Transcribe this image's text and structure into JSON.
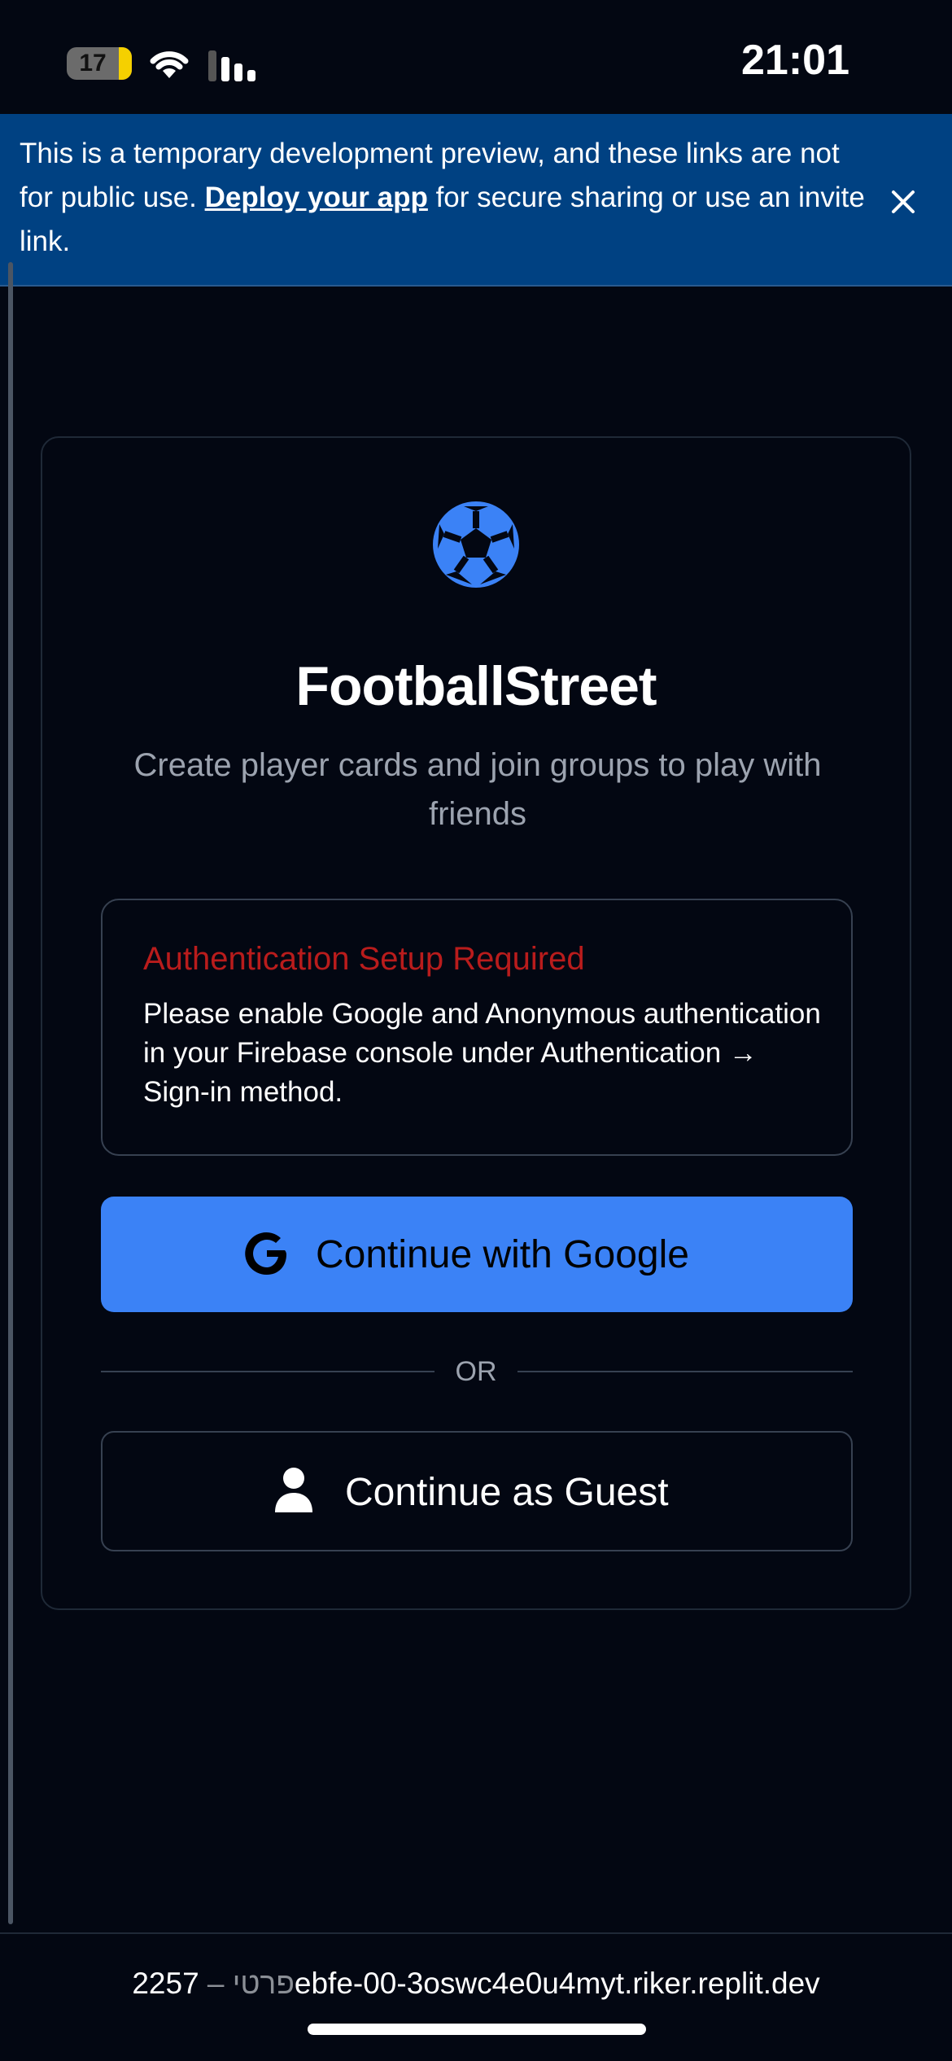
{
  "status_bar": {
    "battery_level": "17",
    "time": "21:01"
  },
  "banner": {
    "text_before": "This is a temporary development preview, and these links are not for public use. ",
    "link_text": "Deploy your app",
    "text_after": " for secure sharing or use an invite link.",
    "close_icon": "close-icon"
  },
  "auth_card": {
    "logo_icon": "soccer-ball-icon",
    "title": "FootballStreet",
    "subtitle": "Create player cards and join groups to play with friends",
    "alert": {
      "title": "Authentication Setup Required",
      "body": "Please enable Google and Anonymous authentication in your Firebase console under Authentication → Sign-in method."
    },
    "google_button": {
      "icon": "google-icon",
      "label": "Continue with Google"
    },
    "divider_label": "OR",
    "guest_button": {
      "icon": "person-icon",
      "label": "Continue as Guest"
    }
  },
  "url_bar": {
    "prefix": "פרטי – ",
    "url": "2257ebfe-00-3oswc4e0u4myt.riker.replit.dev"
  },
  "colors": {
    "background": "#030712",
    "banner": "#004182",
    "primary_button": "#3b82f6",
    "alert_title": "#b91c1c",
    "logo": "#3b82f6"
  }
}
